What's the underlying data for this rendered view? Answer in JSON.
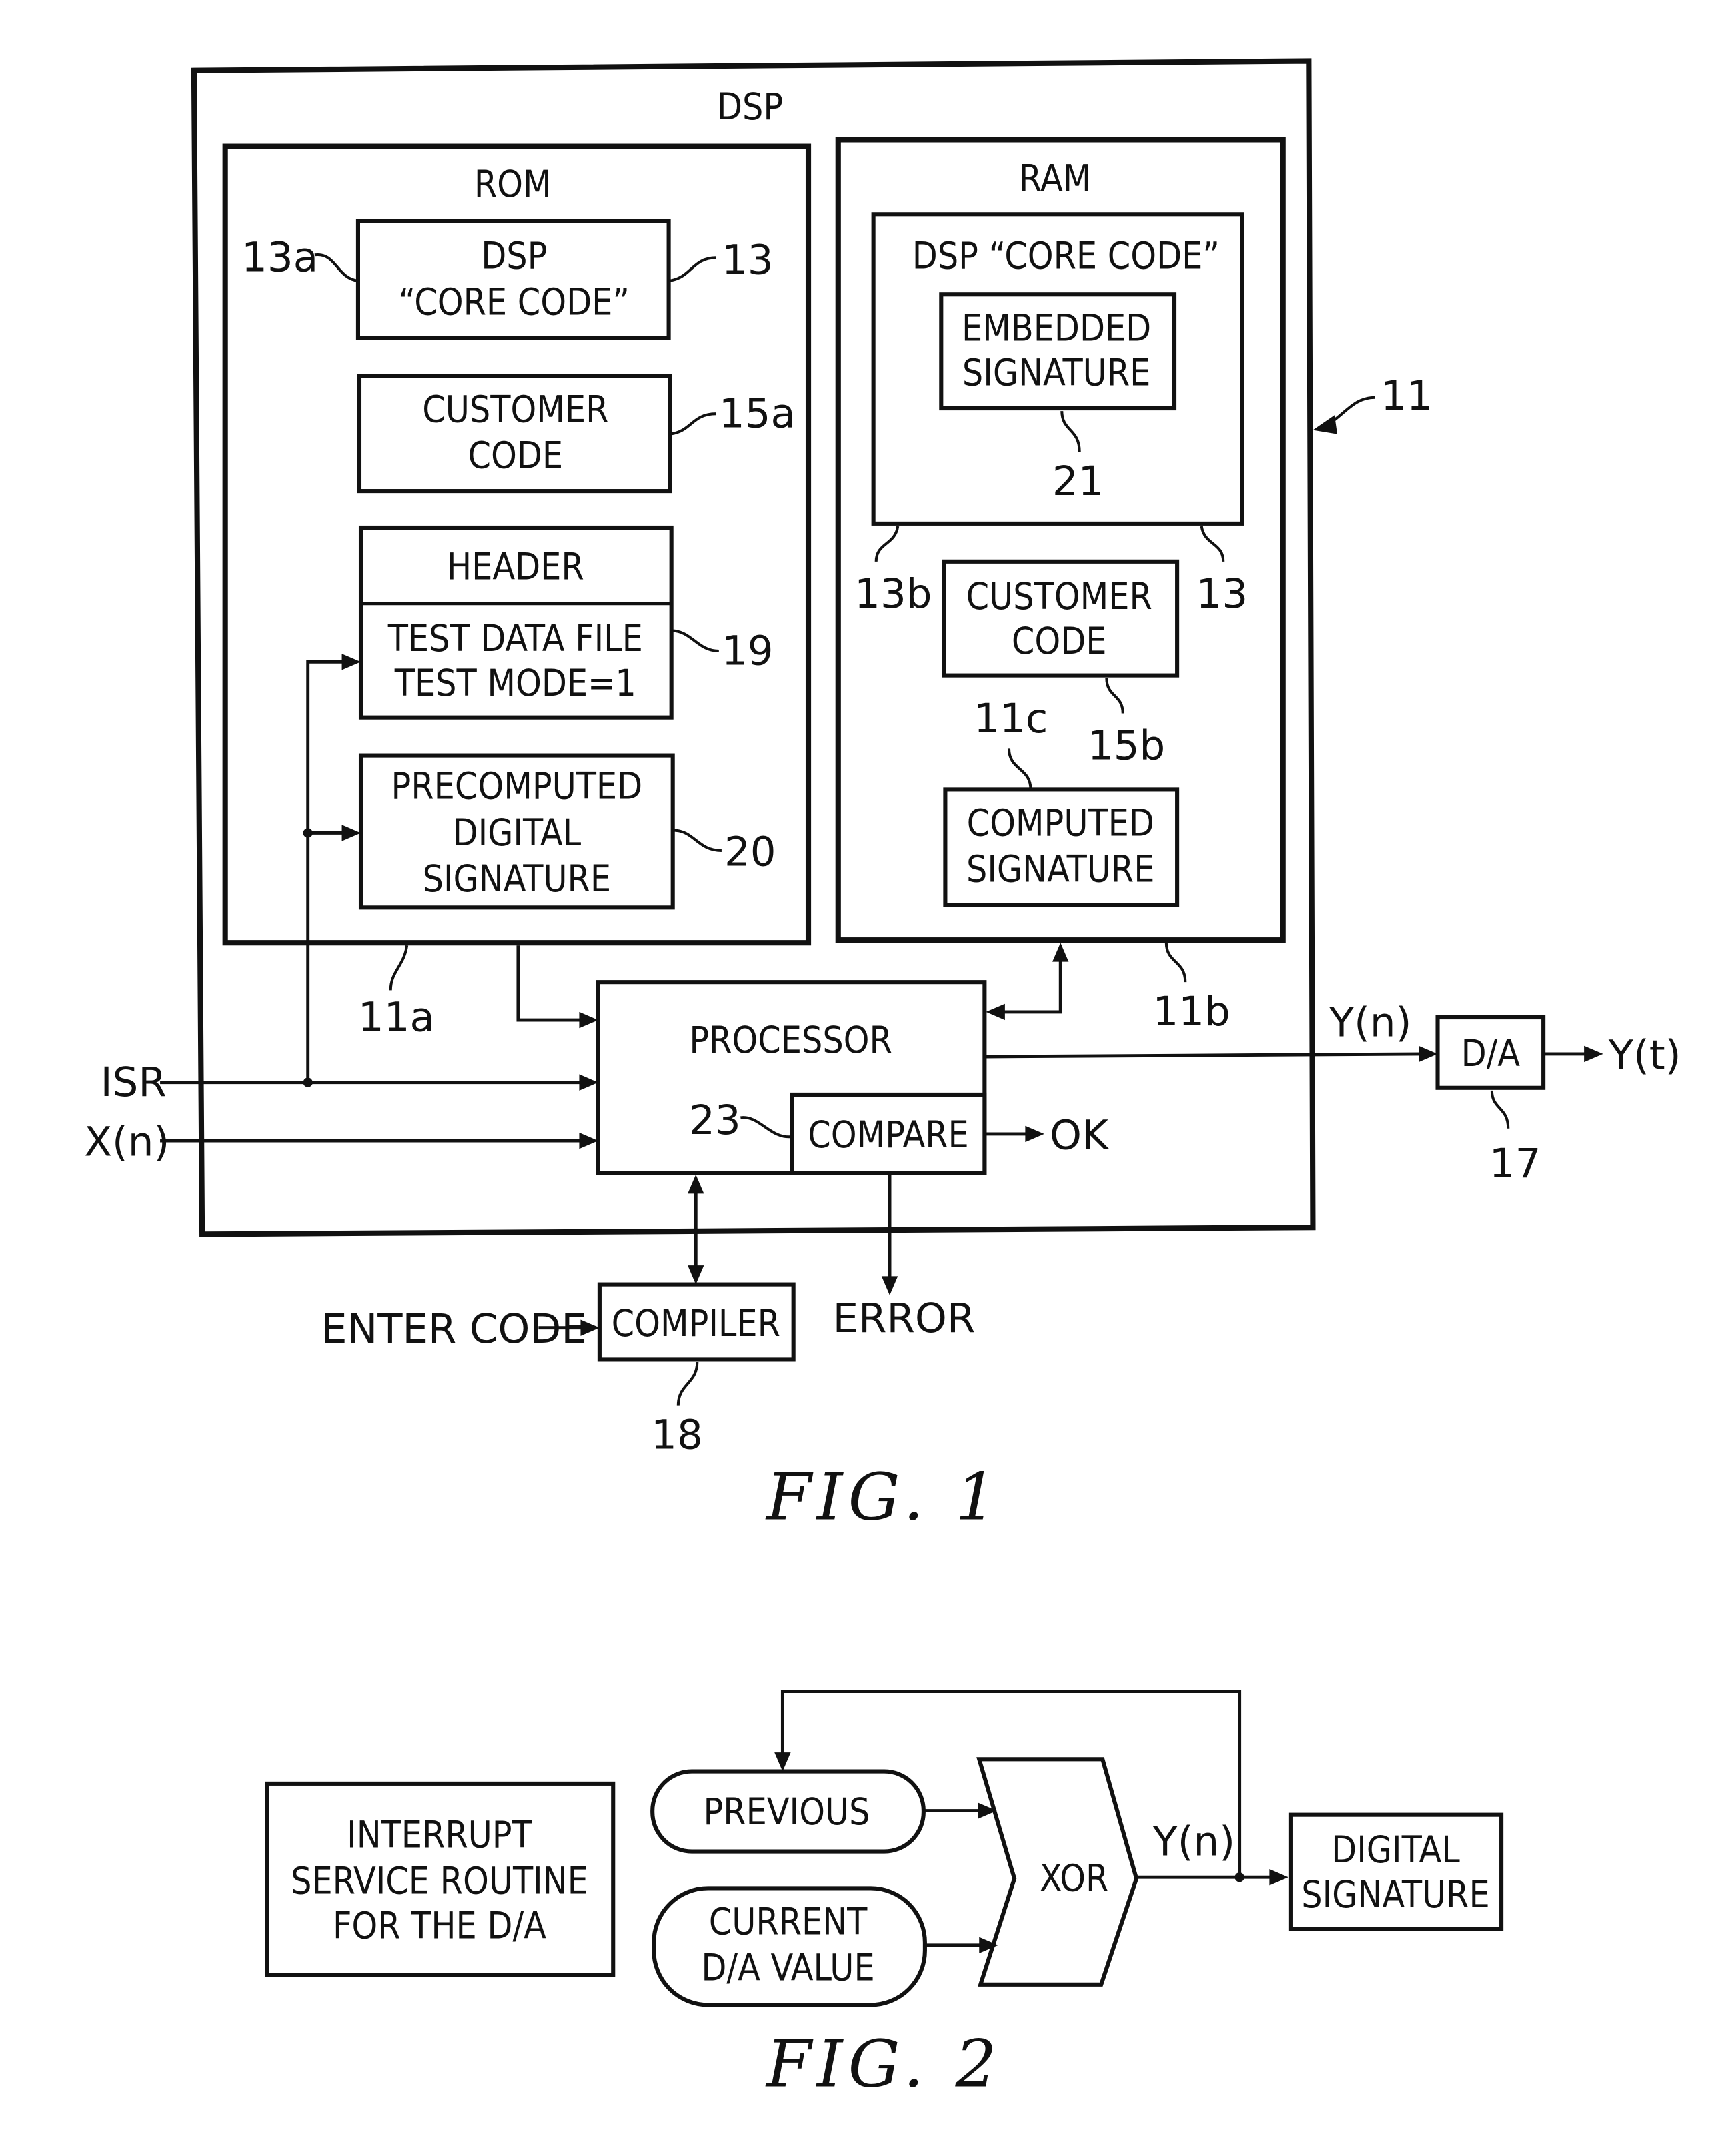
{
  "fig1": {
    "caption": "FIG.  1",
    "dsp": {
      "title": "DSP",
      "ref": "11"
    },
    "rom": {
      "title": "ROM",
      "ref": "11a",
      "core_code": {
        "lines": [
          "DSP",
          "“CORE CODE”"
        ],
        "ref_left": "13a",
        "ref_right": "13"
      },
      "customer_code": {
        "lines": [
          "CUSTOMER",
          "CODE"
        ],
        "ref": "15a"
      },
      "header": {
        "label": "HEADER",
        "lines": [
          "TEST DATA FILE",
          "TEST MODE=1"
        ],
        "ref": "19"
      },
      "precomputed": {
        "lines": [
          "PRECOMPUTED",
          "DIGITAL",
          "SIGNATURE"
        ],
        "ref": "20"
      }
    },
    "ram": {
      "title": "RAM",
      "ref": "11b",
      "core_code": {
        "label": "DSP “CORE CODE”",
        "ref_left": "13b",
        "ref_right": "13"
      },
      "embedded": {
        "lines": [
          "EMBEDDED",
          "SIGNATURE"
        ],
        "ref": "21"
      },
      "customer_code": {
        "lines": [
          "CUSTOMER",
          "CODE"
        ],
        "ref": "15b"
      },
      "computed": {
        "lines": [
          "COMPUTED",
          "SIGNATURE"
        ],
        "ref": "11c"
      }
    },
    "processor": {
      "label": "PROCESSOR"
    },
    "compare": {
      "label": "COMPARE",
      "ref": "23",
      "ok": "OK",
      "error": "ERROR"
    },
    "inputs": {
      "isr": "ISR",
      "x": "X(n)"
    },
    "output": {
      "y_n": "Y(n)",
      "da": "D/A",
      "da_ref": "17",
      "y_t": "Y(t)"
    },
    "compiler": {
      "label": "COMPILER",
      "ref": "18",
      "input": "ENTER CODE"
    }
  },
  "fig2": {
    "caption": "FIG.  2",
    "isr_box": {
      "lines": [
        "INTERRUPT",
        "SERVICE ROUTINE",
        "FOR THE D/A"
      ]
    },
    "previous": "PREVIOUS",
    "current": {
      "lines": [
        "CURRENT",
        "D/A VALUE"
      ]
    },
    "xor": "XOR",
    "y_n": "Y(n)",
    "signature": {
      "lines": [
        "DIGITAL",
        "SIGNATURE"
      ]
    }
  }
}
